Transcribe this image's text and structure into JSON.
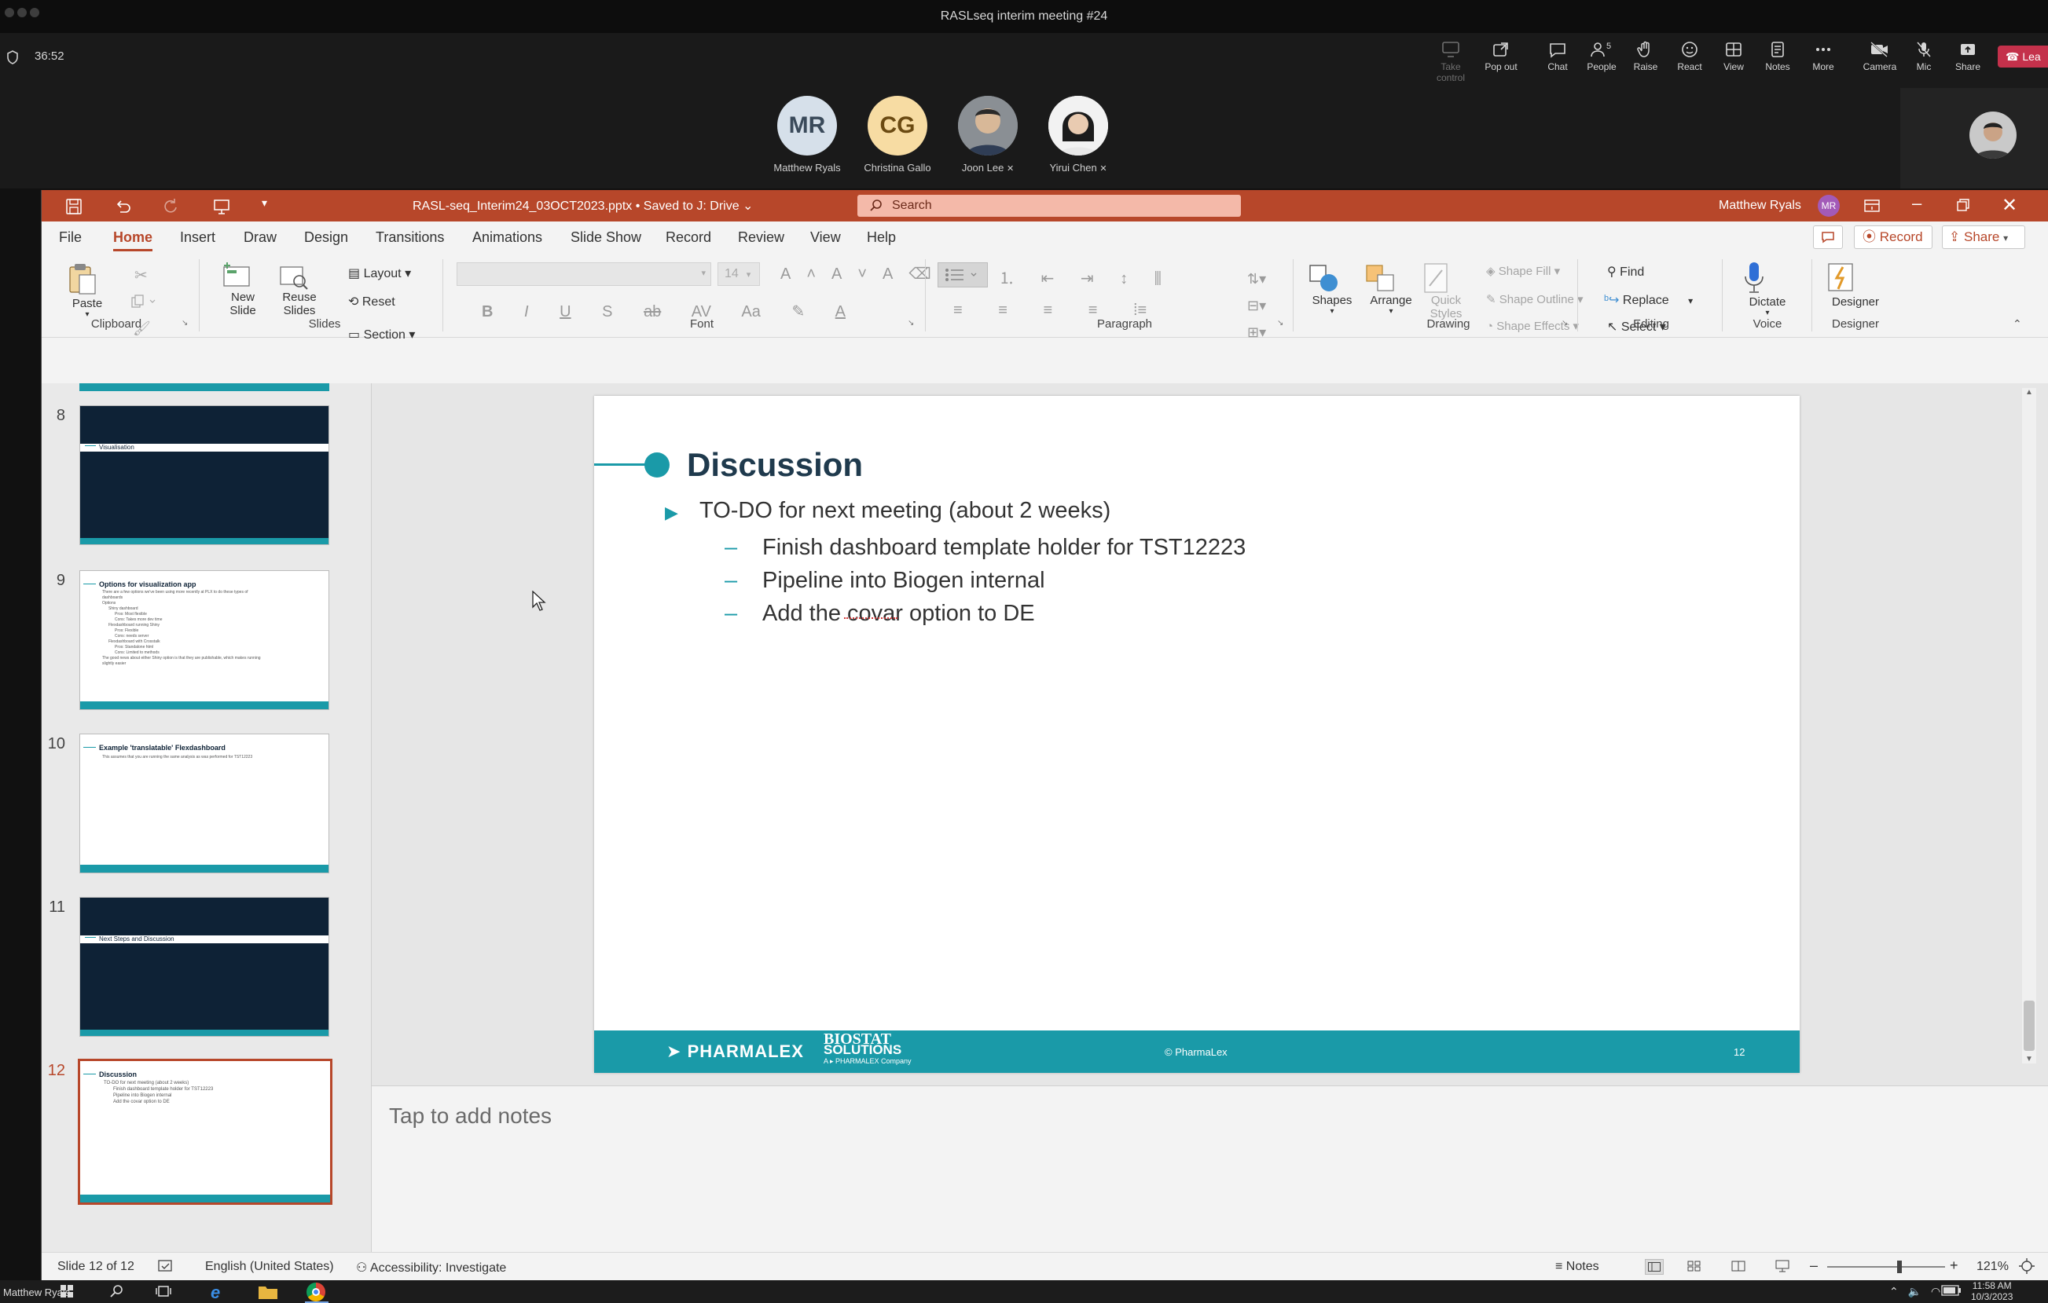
{
  "meeting": {
    "title": "RASLseq interim meeting #24",
    "timer": "36:52",
    "toolbar": [
      {
        "label": "Take control",
        "icon": "take-control-icon",
        "disabled": true
      },
      {
        "label": "Pop out",
        "icon": "pop-out-icon"
      },
      {
        "label": "Chat",
        "icon": "chat-icon"
      },
      {
        "label": "People",
        "icon": "people-icon",
        "count": "5"
      },
      {
        "label": "Raise",
        "icon": "raise-hand-icon"
      },
      {
        "label": "React",
        "icon": "react-icon"
      },
      {
        "label": "View",
        "icon": "view-icon"
      },
      {
        "label": "Notes",
        "icon": "notes-icon"
      },
      {
        "label": "More",
        "icon": "more-icon"
      },
      {
        "label": "Camera",
        "icon": "camera-off-icon"
      },
      {
        "label": "Mic",
        "icon": "mic-off-icon"
      },
      {
        "label": "Share",
        "icon": "share-icon"
      }
    ],
    "leave_label": "Lea",
    "participants": [
      {
        "initials": "MR",
        "name": "Matthew Ryals",
        "color": "#d6e0ea",
        "textcolor": "#3a4a5a"
      },
      {
        "initials": "CG",
        "name": "Christina Gallo",
        "color": "#f7dca3",
        "textcolor": "#6b4a12"
      },
      {
        "initials": "",
        "name": "Joon Lee",
        "muted": true
      },
      {
        "initials": "",
        "name": "Yirui Chen",
        "muted": true
      }
    ]
  },
  "ppt": {
    "filename": "RASL-seq_Interim24_03OCT2023.pptx",
    "saved": "Saved to J: Drive",
    "search_placeholder": "Search",
    "user": "Matthew Ryals",
    "user_initials": "MR",
    "tabs": [
      "File",
      "Home",
      "Insert",
      "Draw",
      "Design",
      "Transitions",
      "Animations",
      "Slide Show",
      "Record",
      "Review",
      "View",
      "Help"
    ],
    "active_tab": "Home",
    "record_label": "Record",
    "share_label": "Share",
    "ribbon": {
      "clipboard": {
        "label": "Clipboard",
        "paste": "Paste"
      },
      "slides": {
        "label": "Slides",
        "new_slide": "New Slide",
        "reuse_slides": "Reuse Slides",
        "layout": "Layout",
        "reset": "Reset",
        "section": "Section"
      },
      "font": {
        "label": "Font",
        "size": "14"
      },
      "paragraph": {
        "label": "Paragraph"
      },
      "drawing": {
        "label": "Drawing",
        "shapes": "Shapes",
        "arrange": "Arrange",
        "quick_styles": "Quick Styles",
        "shape_fill": "Shape Fill",
        "shape_outline": "Shape Outline",
        "shape_effects": "Shape Effects"
      },
      "editing": {
        "label": "Editing",
        "find": "Find",
        "replace": "Replace",
        "select": "Select"
      },
      "voice": {
        "label": "Voice",
        "dictate": "Dictate"
      },
      "designer": {
        "label": "Designer",
        "designer": "Designer"
      }
    },
    "thumbnails": [
      {
        "num": "8",
        "title": "Visualisation",
        "dark": true
      },
      {
        "num": "9",
        "title": "Options for visualization app",
        "dark": false,
        "lines": [
          "There are a few options we've been using more recently at PLX to do these types of",
          "dashboards",
          "Options",
          "Shiny dashboard",
          "Pros: Most flexible",
          "Cons: Takes more dev time",
          "Flexdashboard running Shiny",
          "Pros: Flexible",
          "Cons: needs server",
          "Flexdashboard with Crosstalk",
          "Pros: Standalone html",
          "Cons: Limited to methods",
          "The good news about either Shiny option is that they are publishable, which makes running",
          "slightly easier"
        ]
      },
      {
        "num": "10",
        "title": "Example 'translatable' Flexdashboard",
        "dark": false,
        "lines": [
          "This assumes that you are running the same analysis as was performed for TST12223"
        ]
      },
      {
        "num": "11",
        "title": "Next Steps and Discussion",
        "dark": true
      },
      {
        "num": "12",
        "title": "Discussion",
        "dark": false,
        "selected": true,
        "lines": [
          "TO-DO for next meeting (about 2 weeks)",
          "Finish dashboard template holder for TST12223",
          "Pipeline into Biogen internal",
          "Add the covar option to DE"
        ]
      }
    ],
    "slide": {
      "title": "Discussion",
      "bullet": "TO-DO for next meeting (about 2 weeks)",
      "subbullets": [
        "Finish dashboard template holder for TST12223",
        "Pipeline into Biogen internal",
        "Add the covar option to DE"
      ],
      "footer_logo1": "PHARMALEX",
      "footer_logo2_a": "BIOSTAT",
      "footer_logo2_b": "SOLUTIONS",
      "footer_logo2_c": "A ▸ PHARMALEX Company",
      "footer_copyright": "© PharmaLex",
      "page_number": "12"
    },
    "notes_placeholder": "Tap to add notes",
    "status": {
      "slide": "Slide 12 of 12",
      "language": "English (United States)",
      "accessibility": "Accessibility: Investigate",
      "notes": "Notes",
      "zoom": "121%",
      "zoom_level": 0.61
    }
  },
  "taskbar": {
    "user": "Matthew Ryals",
    "time": "11:58 AM",
    "date": "10/3/2023"
  },
  "colors": {
    "accent": "#b7472a",
    "teal": "#1a9aa8",
    "navy": "#1f3a4d"
  }
}
